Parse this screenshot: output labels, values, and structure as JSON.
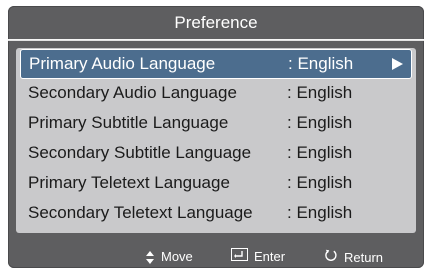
{
  "title": "Preference",
  "items": [
    {
      "label": "Primary Audio Language",
      "value": ": English",
      "selected": true
    },
    {
      "label": "Secondary Audio Language",
      "value": ": English"
    },
    {
      "label": "Primary Subtitle Language",
      "value": ": English"
    },
    {
      "label": "Secondary Subtitle Language",
      "value": ": English"
    },
    {
      "label": "Primary Teletext Language",
      "value": ": English"
    },
    {
      "label": "Secondary Teletext Language",
      "value": ": English"
    }
  ],
  "footer": {
    "move": "Move",
    "enter": "Enter",
    "return": "Return"
  },
  "icons": {
    "selected_arrow": "arrow-right-icon",
    "move": "up-down-arrows-icon",
    "enter": "enter-icon",
    "return": "return-icon"
  },
  "colors": {
    "background": "#5e5e60",
    "panel": "#c9c9cb",
    "highlight": "#4c6d8e",
    "text": "#1b1b1b",
    "light_text": "#ffffff"
  }
}
